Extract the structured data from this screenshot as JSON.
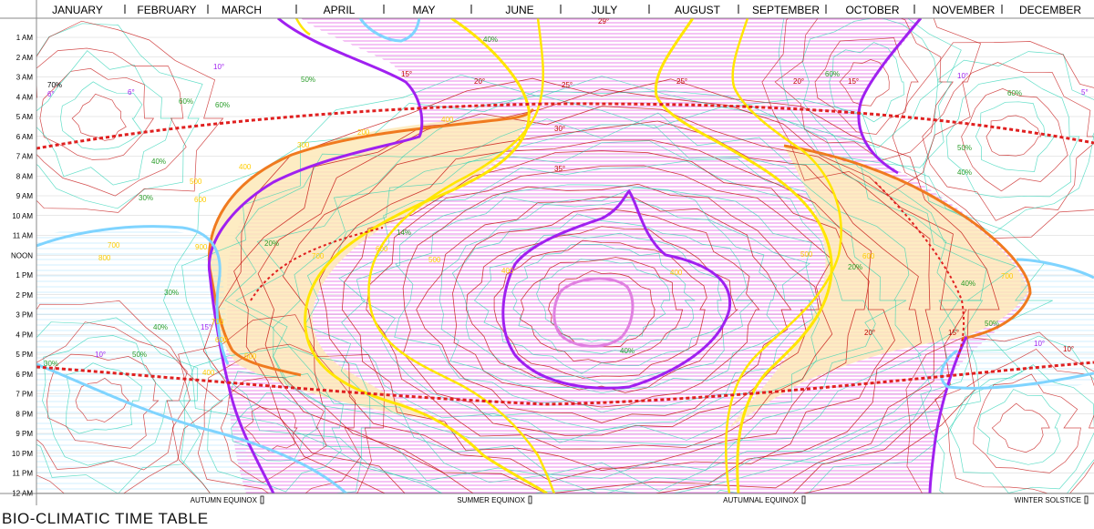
{
  "title": "BIO-CLIMATIC TIME TABLE",
  "chart_data": {
    "type": "heatmap",
    "title": "BIO-CLIMATIC TIME TABLE",
    "months": [
      "JANUARY",
      "FEBRUARY",
      "MARCH",
      "APRIL",
      "MAY",
      "JUNE",
      "JULY",
      "AUGUST",
      "SEPTEMBER",
      "OCTOBER",
      "NOVEMBER",
      "DECEMBER"
    ],
    "hours": [
      "1 AM",
      "2 AM",
      "3 AM",
      "4 AM",
      "5 AM",
      "6 AM",
      "7 AM",
      "8 AM",
      "9 AM",
      "10 AM",
      "11 AM",
      "NOON",
      "1 PM",
      "2 PM",
      "3 PM",
      "4 PM",
      "5 PM",
      "6 PM",
      "7 PM",
      "8 PM",
      "9 PM",
      "10 PM",
      "11 PM",
      "12 AM"
    ],
    "season_markers": [
      "AUTUMN EQUINOX",
      "SUMMER EQUINOX",
      "AUTUMNAL EQUINOX",
      "WINTER SOLSTICE"
    ],
    "temperature_labels": [
      "5°",
      "6°",
      "10°",
      "15°",
      "20°",
      "25°",
      "29°",
      "30°",
      "35°"
    ],
    "humidity_labels": [
      "14%",
      "20%",
      "30%",
      "40%",
      "50%",
      "60%",
      "70%"
    ],
    "radiation_labels": [
      "100",
      "200",
      "300",
      "400",
      "500",
      "600",
      "700",
      "800",
      "900"
    ],
    "colors": {
      "sunrise_sunset": "#e02020",
      "comfort_zone": "#f59a23",
      "shading_zone": "#ffe600",
      "overheated": "#a020f0",
      "hot_core": "#e080e0",
      "underheated": "#7fd4ff",
      "temp_isolines": "#c00000",
      "humidity_isolines": "#20d0b0",
      "hatch": "#e040e0"
    }
  }
}
